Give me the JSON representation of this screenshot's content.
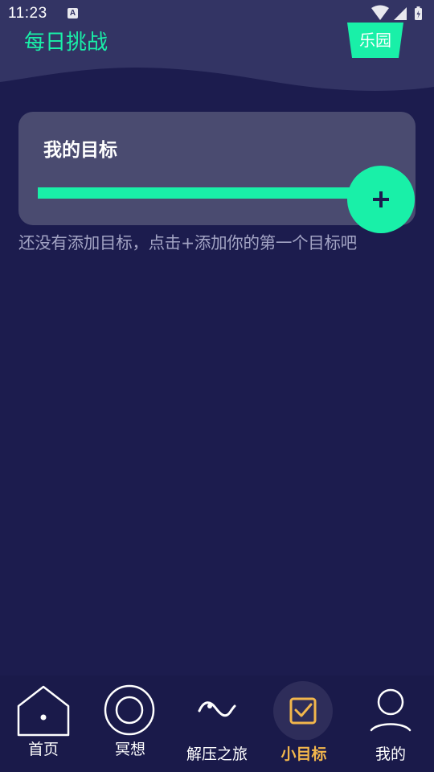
{
  "status_bar": {
    "time": "11:23",
    "notification_icon": "a-icon",
    "icons": [
      "wifi-icon",
      "signal-icon",
      "battery-icon"
    ]
  },
  "header": {
    "title": "每日挑战",
    "park_button_label": "乐园"
  },
  "goal_card": {
    "title": "我的目标",
    "progress_fraction": 1.0,
    "add_button_icon": "plus-icon"
  },
  "empty_hint": "还没有添加目标，点击+添加你的第一个目标吧",
  "bottom_nav": {
    "items": [
      {
        "label": "首页",
        "icon": "house-icon",
        "active": false
      },
      {
        "label": "冥想",
        "icon": "circle-icon",
        "active": false
      },
      {
        "label": "解压之旅",
        "icon": "wave-icon",
        "active": false
      },
      {
        "label": "小目标",
        "icon": "checkbox-icon",
        "active": true
      },
      {
        "label": "我的",
        "icon": "person-icon",
        "active": false
      }
    ]
  },
  "colors": {
    "background": "#1c1c4e",
    "header": "#333464",
    "accent": "#19f0a8",
    "card": "#4a4b70",
    "active_tab": "#f2b64c",
    "hint_text": "#a3a4c4"
  }
}
